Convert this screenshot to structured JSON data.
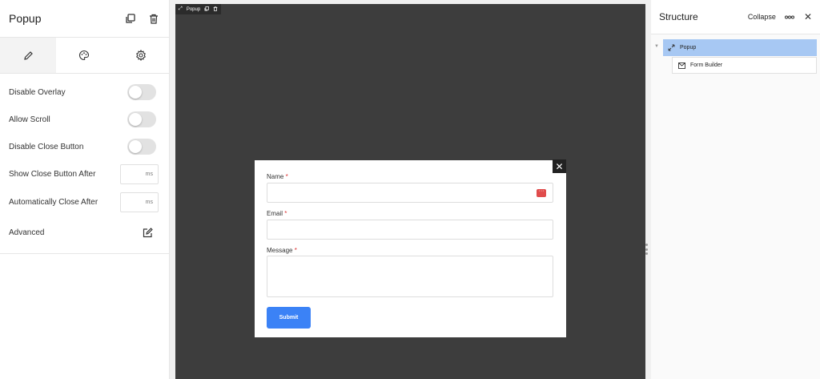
{
  "left_panel": {
    "title": "Popup",
    "settings": [
      {
        "label": "Disable Overlay",
        "type": "toggle",
        "value": false
      },
      {
        "label": "Allow Scroll",
        "type": "toggle",
        "value": false
      },
      {
        "label": "Disable Close Button",
        "type": "toggle",
        "value": false
      },
      {
        "label": "Show Close Button After",
        "type": "input",
        "unit": "ms"
      },
      {
        "label": "Automatically Close After",
        "type": "input",
        "unit": "ms"
      },
      {
        "label": "Advanced",
        "type": "action"
      }
    ]
  },
  "canvas": {
    "tag_label": "Popup",
    "form": {
      "fields": [
        {
          "label": "Name",
          "required_mark": "*"
        },
        {
          "label": "Email",
          "required_mark": "*"
        },
        {
          "label": "Message",
          "required_mark": "*"
        }
      ],
      "submit_label": "Submit"
    },
    "close_glyph": "✕",
    "background_color": "#3d3d3d",
    "accent_color": "#3b82f6"
  },
  "right_panel": {
    "title": "Structure",
    "collapse_label": "Collapse",
    "tree": [
      {
        "label": "Popup",
        "icon": "expand-icon",
        "selected": true
      },
      {
        "label": "Form Builder",
        "icon": "envelope-icon",
        "selected": false
      }
    ],
    "selected_color": "#a7c8f3"
  }
}
